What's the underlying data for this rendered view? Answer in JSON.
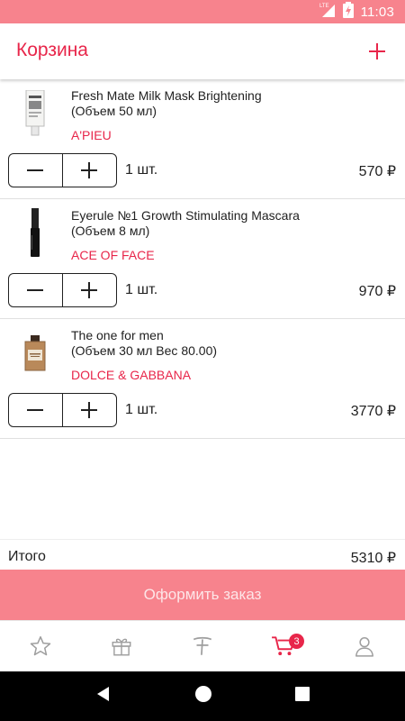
{
  "status_bar": {
    "network": "LTE",
    "time": "11:03"
  },
  "header": {
    "title": "Корзина"
  },
  "items": [
    {
      "name": "Fresh Mate Milk Mask Brightening",
      "volume": "(Объем 50 мл)",
      "brand": "A'PIEU",
      "qty": "1 шт.",
      "price": "570 ₽",
      "image": "milk-mask-tube"
    },
    {
      "name": "Eyerule №1 Growth Stimulating Mascara",
      "volume": "(Объем 8 мл)",
      "brand": "ACE OF FACE",
      "qty": "1 шт.",
      "price": "970 ₽",
      "image": "mascara"
    },
    {
      "name": "The one for men",
      "volume": "(Объем 30 мл Вес 80.00)",
      "brand": "DOLCE & GABBANA",
      "qty": "1 шт.",
      "price": "3770 ₽",
      "image": "perfume-bottle"
    }
  ],
  "total": {
    "label": "Итого",
    "value": "5310 ₽"
  },
  "checkout": {
    "label": "Оформить заказ"
  },
  "bottom_nav": {
    "items": [
      {
        "icon": "star-icon"
      },
      {
        "icon": "gift-icon"
      },
      {
        "icon": "brand-logo-icon"
      },
      {
        "icon": "cart-icon",
        "badge": "3",
        "active": true
      },
      {
        "icon": "profile-icon"
      }
    ]
  },
  "colors": {
    "accent": "#e8264a",
    "primary_light": "#f7838d",
    "text": "#212121",
    "inactive_icon": "#9e9e9e"
  }
}
